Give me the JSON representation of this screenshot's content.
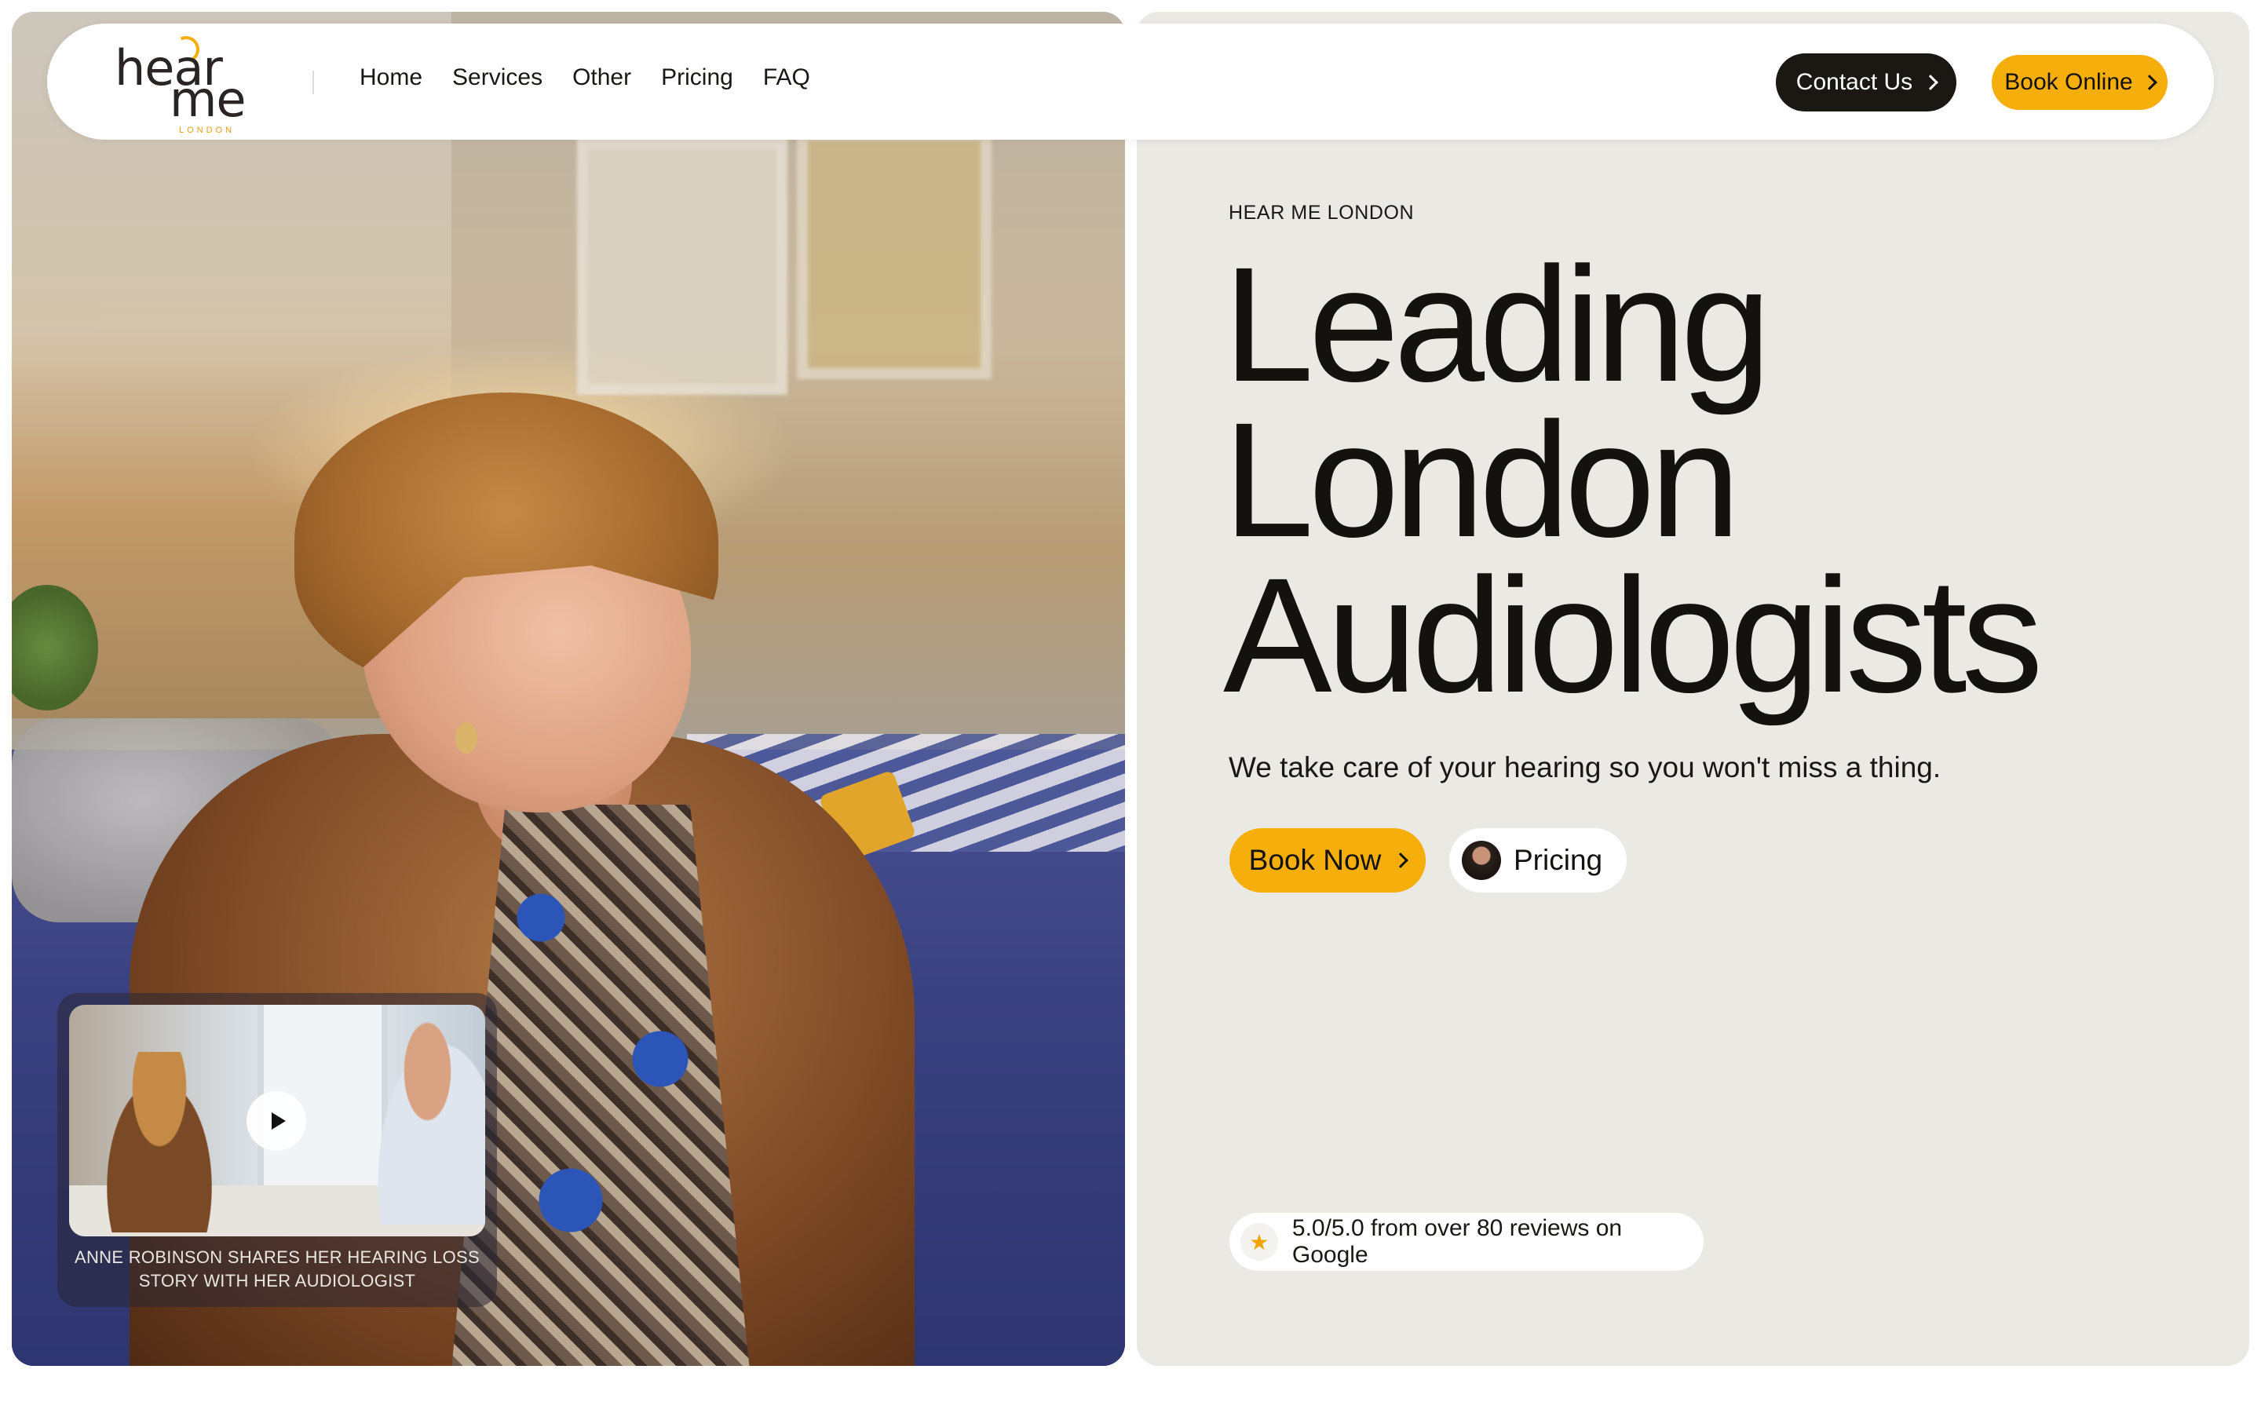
{
  "header": {
    "logo": {
      "word1": "hear",
      "word2": "me",
      "word3": "LONDON"
    },
    "nav": [
      "Home",
      "Services",
      "Other",
      "Pricing",
      "FAQ"
    ],
    "contact_label": "Contact Us",
    "book_online_label": "Book Online"
  },
  "video": {
    "caption": "ANNE ROBINSON SHARES HER HEARING LOSS STORY WITH HER AUDIOLOGIST",
    "play_icon": "play-icon"
  },
  "hero": {
    "eyebrow": "HEAR ME LONDON",
    "headline": [
      "Leading",
      "London",
      "Audiologists"
    ],
    "subline": "We take care of your hearing so you won't miss a thing.",
    "book_now_label": "Book Now",
    "pricing_label": "Pricing",
    "reviews_text": "5.0/5.0 from over 80 reviews on Google"
  },
  "colors": {
    "accent": "#f5ae0a",
    "dark_button": "#1b1813",
    "panel_bg": "#ebe9e4"
  }
}
